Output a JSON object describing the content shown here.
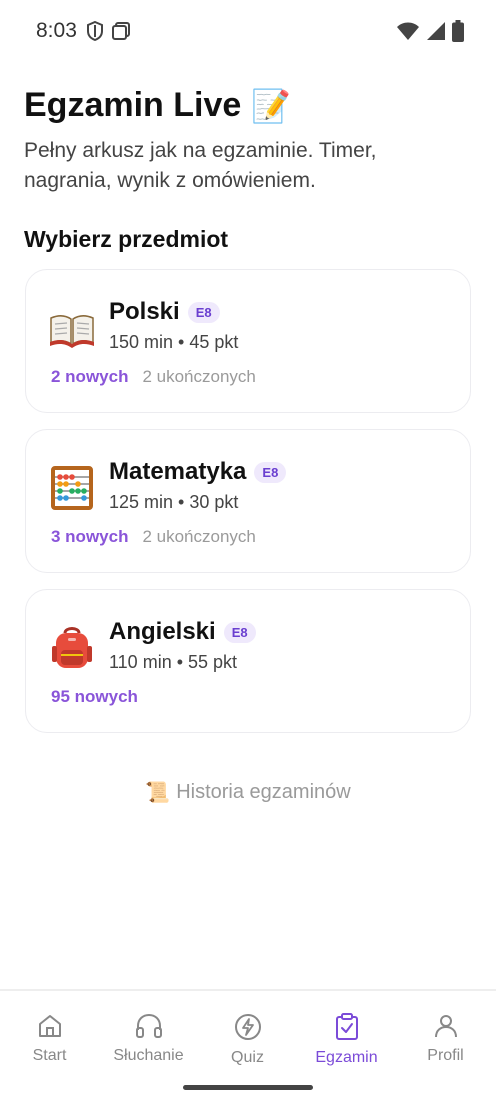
{
  "status_bar": {
    "time": "8:03"
  },
  "header": {
    "title": "Egzamin Live",
    "title_emoji": "📝",
    "subtitle": "Pełny arkusz jak na egzaminie. Timer, nagrania, wynik z omówieniem."
  },
  "section": {
    "heading": "Wybierz przedmiot"
  },
  "subjects": [
    {
      "name": "Polski",
      "badge": "E8",
      "meta": "150 min • 45 pkt",
      "new": "2 nowych",
      "done": "2 ukończonych",
      "icon": "book-icon"
    },
    {
      "name": "Matematyka",
      "badge": "E8",
      "meta": "125 min • 30 pkt",
      "new": "3 nowych",
      "done": "2 ukończonych",
      "icon": "abacus-icon"
    },
    {
      "name": "Angielski",
      "badge": "E8",
      "meta": "110 min • 55 pkt",
      "new": "95 nowych",
      "icon": "backpack-icon"
    }
  ],
  "history": {
    "emoji": "📜",
    "label": "Historia egzaminów"
  },
  "bottom_nav": [
    {
      "label": "Start",
      "icon": "home-icon"
    },
    {
      "label": "Słuchanie",
      "icon": "headphones-icon"
    },
    {
      "label": "Quiz",
      "icon": "lightning-icon"
    },
    {
      "label": "Egzamin",
      "icon": "checklist-icon",
      "active": true
    },
    {
      "label": "Profil",
      "icon": "person-icon"
    }
  ],
  "colors": {
    "accent": "#7b4bd8",
    "badge_bg": "#efe9fc",
    "muted": "#9a9a9a"
  }
}
